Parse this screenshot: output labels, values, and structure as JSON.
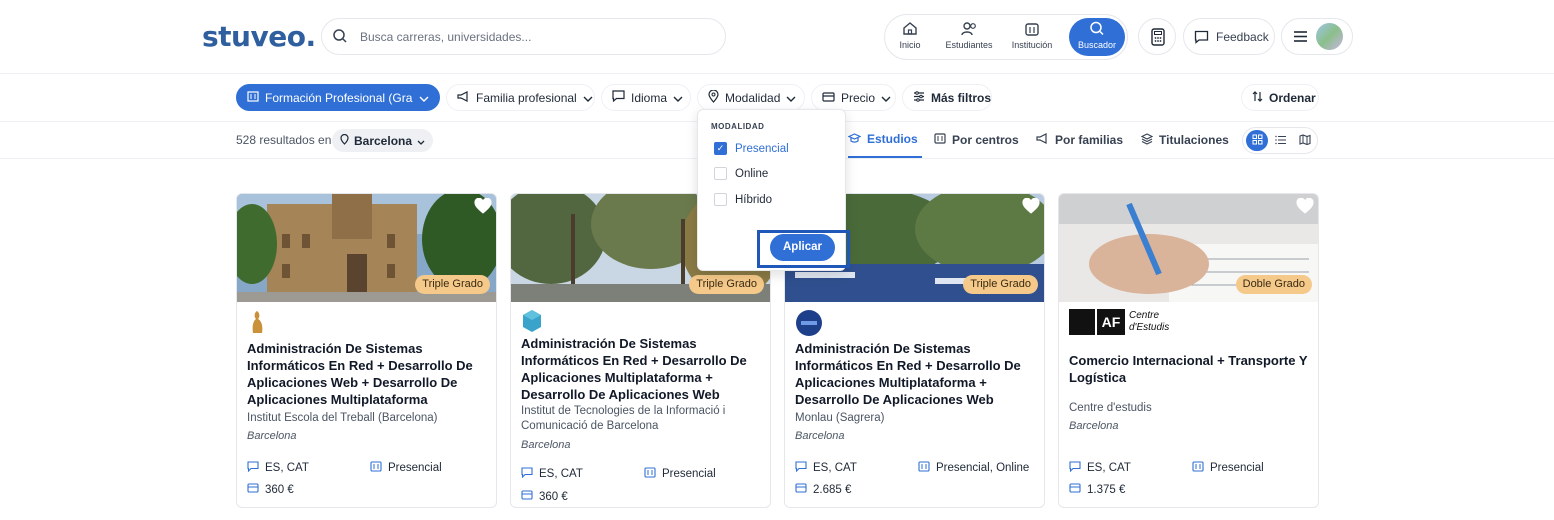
{
  "brand": {
    "logo": "stuveo."
  },
  "search": {
    "placeholder": "Busca carreras, universidades..."
  },
  "nav": [
    {
      "label": "Inicio",
      "icon": "home-icon"
    },
    {
      "label": "Estudiantes",
      "icon": "users-icon"
    },
    {
      "label": "Institución",
      "icon": "building-icon"
    },
    {
      "label": "Buscador",
      "icon": "search-icon",
      "active": true
    }
  ],
  "header": {
    "feedback_label": "Feedback"
  },
  "filters": {
    "type": "Formación Profesional (Gra...",
    "family": "Familia profesional",
    "language": "Idioma",
    "mode": "Modalidad",
    "price": "Precio",
    "more": "Más filtros",
    "sort": "Ordenar"
  },
  "results": {
    "count_text": "528 resultados en",
    "location": "Barcelona"
  },
  "tabs": [
    {
      "label": "Estudios",
      "active": true
    },
    {
      "label": "Por centros"
    },
    {
      "label": "Por familias"
    },
    {
      "label": "Titulaciones"
    }
  ],
  "dropdown": {
    "title": "MODALIDAD",
    "options": [
      {
        "label": "Presencial",
        "checked": true
      },
      {
        "label": "Online",
        "checked": false
      },
      {
        "label": "Híbrido",
        "checked": false
      }
    ],
    "apply_label": "Aplicar"
  },
  "cards": [
    {
      "badge": "Triple Grado",
      "title": "Administración De Sistemas Informáticos En Red + Desarrollo De Aplicaciones Web + Desarrollo De Aplicaciones Multiplataforma",
      "institution": "Institut Escola del Treball (Barcelona)",
      "city": "Barcelona",
      "languages": "ES, CAT",
      "mode": "Presencial",
      "price": "360 €"
    },
    {
      "badge": "Triple Grado",
      "title": "Administración De Sistemas Informáticos En Red + Desarrollo De Aplicaciones Multiplataforma + Desarrollo De Aplicaciones Web",
      "institution": "Institut de Tecnologies de la Informació i Comunicació de Barcelona",
      "city": "Barcelona",
      "languages": "ES, CAT",
      "mode": "Presencial",
      "price": "360 €"
    },
    {
      "badge": "Triple Grado",
      "title": "Administración De Sistemas Informáticos En Red + Desarrollo De Aplicaciones Multiplataforma + Desarrollo De Aplicaciones Web",
      "institution": "Monlau (Sagrera)",
      "city": "Barcelona",
      "languages": "ES, CAT",
      "mode": "Presencial, Online",
      "price": "2.685 €"
    },
    {
      "badge": "Doble Grado",
      "title": "Comercio Internacional + Transporte Y Logística",
      "institution": "Centre d'estudis",
      "city": "Barcelona",
      "languages": "ES, CAT",
      "mode": "Presencial",
      "price": "1.375 €",
      "logo_text": {
        "mark": "AF",
        "line1": "Centre",
        "line2": "d'Estudis"
      }
    }
  ],
  "colors": {
    "accent": "#2f6fd6",
    "badge": "#f4c98a",
    "brand": "#2f5f9e"
  }
}
